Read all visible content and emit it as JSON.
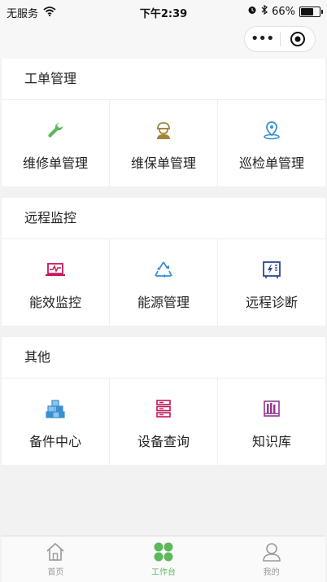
{
  "status_bar": {
    "carrier": "无服务",
    "time": "下午2:39",
    "battery_percent": "66%",
    "battery_level": 0.66
  },
  "nav": {
    "more_label": "•••"
  },
  "sections": [
    {
      "title": "工单管理",
      "items": [
        {
          "label": "维修单管理",
          "icon": "wrench-icon",
          "color": "#5cb85c"
        },
        {
          "label": "维保单管理",
          "icon": "worker-icon",
          "color": "#a08638"
        },
        {
          "label": "巡检单管理",
          "icon": "location-pin-icon",
          "color": "#3a8fd0"
        }
      ]
    },
    {
      "title": "远程监控",
      "items": [
        {
          "label": "能效监控",
          "icon": "laptop-pulse-icon",
          "color": "#c2185b"
        },
        {
          "label": "能源管理",
          "icon": "recycle-icon",
          "color": "#3a8fd0"
        },
        {
          "label": "远程诊断",
          "icon": "lightning-panel-icon",
          "color": "#2c4a8a"
        }
      ]
    },
    {
      "title": "其他",
      "items": [
        {
          "label": "备件中心",
          "icon": "cubes-icon",
          "color": "#3a8fd0"
        },
        {
          "label": "设备查询",
          "icon": "server-stack-icon",
          "color": "#c2185b"
        },
        {
          "label": "知识库",
          "icon": "bookshelf-icon",
          "color": "#8e3a8f"
        }
      ]
    }
  ],
  "tabbar": [
    {
      "label": "首页",
      "icon": "home-icon",
      "active": false
    },
    {
      "label": "工作台",
      "icon": "four-dots-icon",
      "active": true
    },
    {
      "label": "我的",
      "icon": "user-icon",
      "active": false
    }
  ],
  "colors": {
    "accent": "#5cb85c",
    "background": "#f2f2f2"
  }
}
